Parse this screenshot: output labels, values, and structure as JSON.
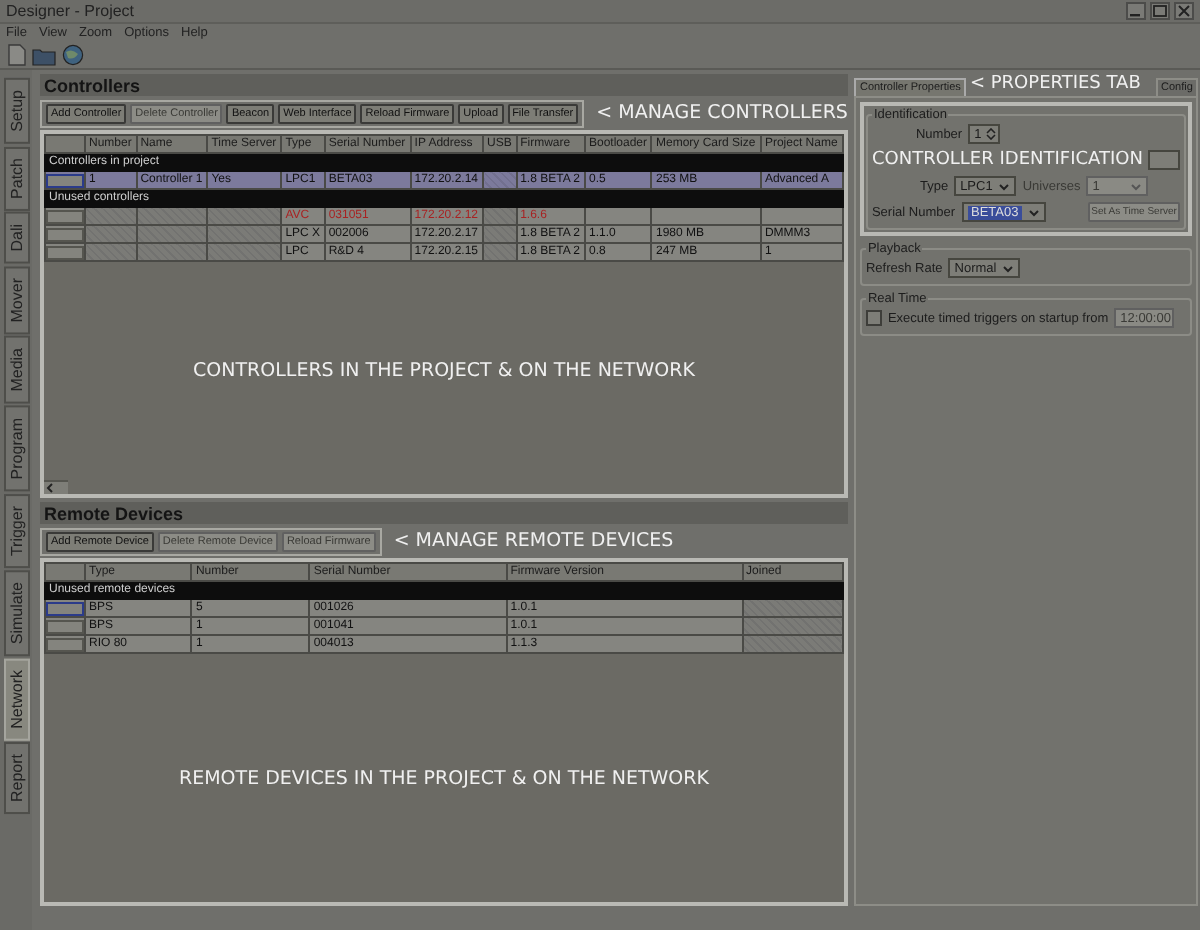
{
  "window": {
    "title": "Designer - Project"
  },
  "menu": [
    "File",
    "View",
    "Zoom",
    "Options",
    "Help"
  ],
  "side_tabs": [
    {
      "label": "Setup",
      "selected": false
    },
    {
      "label": "Patch",
      "selected": false
    },
    {
      "label": "Dali",
      "selected": false
    },
    {
      "label": "Mover",
      "selected": false
    },
    {
      "label": "Media",
      "selected": false
    },
    {
      "label": "Program",
      "selected": false
    },
    {
      "label": "Trigger",
      "selected": false
    },
    {
      "label": "Simulate",
      "selected": false
    },
    {
      "label": "Network",
      "selected": true
    },
    {
      "label": "Report",
      "selected": false
    }
  ],
  "controllers": {
    "title": "Controllers",
    "buttons": [
      {
        "label": "Add Controller",
        "disabled": false
      },
      {
        "label": "Delete Controller",
        "disabled": true
      },
      {
        "label": "Beacon",
        "disabled": false
      },
      {
        "label": "Web Interface",
        "disabled": false
      },
      {
        "label": "Reload Firmware",
        "disabled": false
      },
      {
        "label": "Upload",
        "disabled": false
      },
      {
        "label": "File Transfer",
        "disabled": false
      }
    ],
    "note": "< MANAGE CONTROLLERS",
    "columns": [
      "Number",
      "Name",
      "Time Server",
      "Type",
      "Serial Number",
      "IP Address",
      "USB",
      "Firmware",
      "Bootloader",
      "Memory Card Size",
      "Project Name"
    ],
    "groups": [
      {
        "label": "Controllers in project",
        "rows": [
          {
            "selected": true,
            "error": false,
            "cells": [
              "1",
              "Controller 1",
              "Yes",
              "LPC1",
              "BETA03",
              "172.20.2.14",
              null,
              "1.8 BETA 2",
              "0.5",
              "253 MB",
              "Advanced A"
            ]
          }
        ]
      },
      {
        "label": "Unused controllers",
        "rows": [
          {
            "selected": false,
            "error": true,
            "cells": [
              null,
              null,
              null,
              "AVC",
              "031051",
              "172.20.2.12",
              null,
              "1.6.6",
              null,
              null,
              null
            ]
          },
          {
            "selected": false,
            "error": false,
            "cells": [
              null,
              null,
              null,
              "LPC X",
              "002006",
              "172.20.2.17",
              null,
              "1.8 BETA 2",
              "1.1.0",
              "1980 MB",
              "DMMM3"
            ]
          },
          {
            "selected": false,
            "error": false,
            "cells": [
              null,
              null,
              null,
              "LPC",
              "R&D 4",
              "172.20.2.15",
              null,
              "1.8 BETA 2",
              "0.8",
              "247 MB",
              "1"
            ]
          }
        ]
      }
    ],
    "area_note": "CONTROLLERS IN THE PROJECT & ON THE NETWORK"
  },
  "remote_devices": {
    "title": "Remote Devices",
    "buttons": [
      {
        "label": "Add Remote Device",
        "disabled": false
      },
      {
        "label": "Delete Remote Device",
        "disabled": true
      },
      {
        "label": "Reload Firmware",
        "disabled": true
      }
    ],
    "note": "< MANAGE REMOTE DEVICES",
    "columns": [
      "Type",
      "Number",
      "Serial Number",
      "Firmware Version",
      "Joined"
    ],
    "groups": [
      {
        "label": "Unused remote devices",
        "rows": [
          {
            "selected": false,
            "cells": [
              "BPS",
              "5",
              "001026",
              "1.0.1",
              null
            ]
          },
          {
            "selected": false,
            "cells": [
              "BPS",
              "1",
              "001041",
              "1.0.1",
              null
            ]
          },
          {
            "selected": false,
            "cells": [
              "RIO 80",
              "1",
              "004013",
              "1.1.3",
              null
            ]
          }
        ]
      }
    ],
    "area_note": "REMOTE DEVICES IN THE PROJECT & ON THE NETWORK"
  },
  "properties": {
    "tabs": [
      {
        "label": "Controller Properties",
        "selected": true
      },
      {
        "label": "Config",
        "selected": false
      }
    ],
    "tab_note": "< PROPERTIES TAB",
    "identification": {
      "title": "Identification",
      "number_label": "Number",
      "number": "1",
      "note": "CONTROLLER IDENTIFICATION",
      "type_label": "Type",
      "type": "LPC1",
      "universes_label": "Universes",
      "universes": "1",
      "serial_label": "Serial Number",
      "serial": "BETA03",
      "time_server_button": "Set As Time Server"
    },
    "playback": {
      "title": "Playback",
      "refresh_label": "Refresh Rate",
      "refresh": "Normal"
    },
    "real_time": {
      "title": "Real Time",
      "checkbox_label": "Execute timed triggers on startup from",
      "checked": false,
      "time": "12:00:00"
    }
  }
}
